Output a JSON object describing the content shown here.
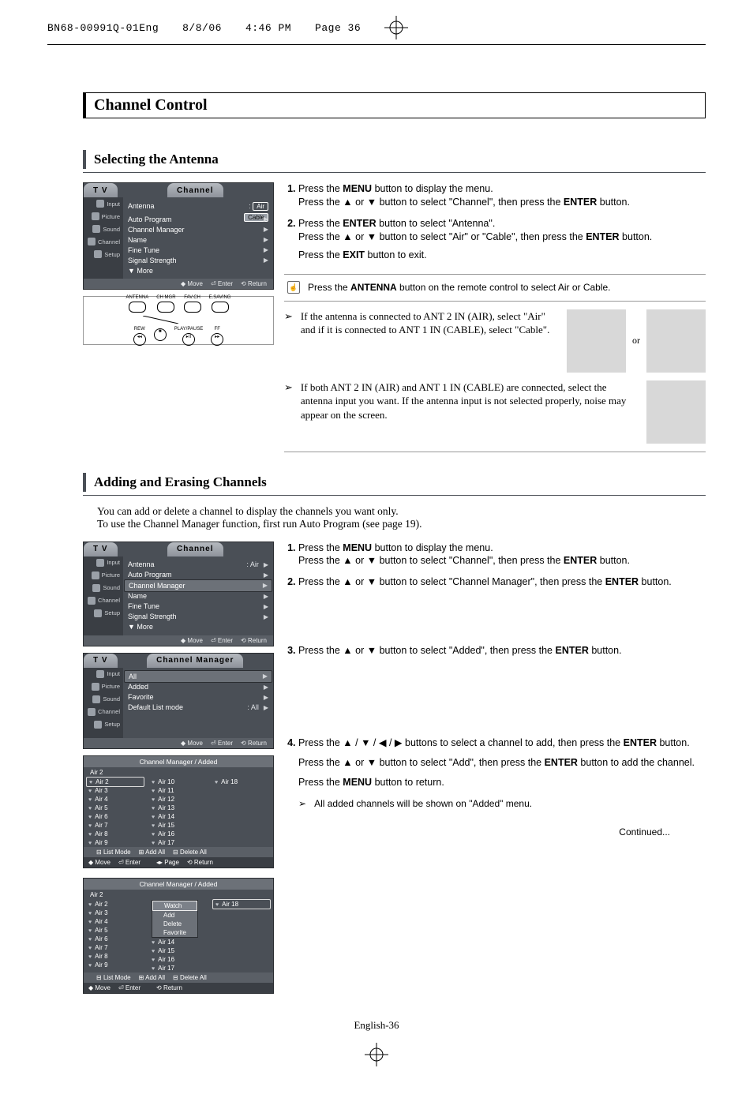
{
  "print_header": {
    "code": "BN68-00991Q-01Eng",
    "date": "8/8/06",
    "time": "4:46 PM",
    "page": "Page 36"
  },
  "main_title": "Channel Control",
  "section1": {
    "title": "Selecting the Antenna",
    "osd": {
      "tab_left": "T V",
      "tab_center": "Channel",
      "side": [
        "Input",
        "Picture",
        "Sound",
        "Channel",
        "Setup"
      ],
      "rows": [
        {
          "lbl": "Antenna",
          "val": ":",
          "opts": [
            "Air",
            "Cable"
          ],
          "sel": 0
        },
        {
          "lbl": "Auto Program",
          "tri": true
        },
        {
          "lbl": "Channel Manager",
          "tri": true
        },
        {
          "lbl": "Name",
          "tri": true
        },
        {
          "lbl": "Fine Tune",
          "tri": true
        },
        {
          "lbl": "Signal Strength",
          "tri": true
        },
        {
          "lbl": "▼ More"
        }
      ],
      "foot": [
        "Move",
        "Enter",
        "Return"
      ]
    },
    "remote_labels_top": [
      "ANTENNA",
      "CH MGR",
      "FAV.CH",
      "E.SAVING"
    ],
    "remote_labels_bot": [
      "REW",
      "",
      "PLAY/PAUSE",
      "FF"
    ],
    "steps": [
      {
        "n": "1.",
        "lines": [
          {
            "t": "Press the ",
            "b": "MENU",
            "t2": " button to display the menu."
          },
          {
            "t": "Press the ",
            "icon": "up",
            "t2": " or ",
            "icon2": "down",
            "t3": " button to select \"Channel\", then press the ",
            "b": "ENTER",
            "t4": " button."
          }
        ]
      },
      {
        "n": "2.",
        "lines": [
          {
            "t": "Press the ",
            "b": "ENTER",
            "t2": " button to select \"Antenna\"."
          },
          {
            "t": "Press the ",
            "icon": "up",
            "t2": " or ",
            "icon2": "down",
            "t3": " button to select \"Air\" or \"Cable\", then press the ",
            "b": "ENTER",
            "t4": " button."
          },
          {
            "t": "Press the ",
            "b": "EXIT",
            "t2": " button to exit."
          }
        ]
      }
    ],
    "note": {
      "pre": "Press the ",
      "b": "ANTENNA",
      "post": " button on the remote control to select Air or Cable."
    },
    "tip1": "If the antenna is connected to ANT 2 IN (AIR), select \"Air\" and if it is connected to ANT 1 IN (CABLE), select \"Cable\".",
    "tip1_or": "or",
    "tip2": "If both ANT 2 IN (AIR) and ANT 1 IN (CABLE) are connected, select the antenna input you want. If the antenna input is not selected properly, noise may appear on the screen."
  },
  "section2": {
    "title": "Adding and Erasing Channels",
    "intro1": "You can add or delete a channel to display the channels you want only.",
    "intro2": "To use the Channel Manager function, first run Auto Program (see page 19).",
    "osd1": {
      "tab_left": "T V",
      "tab_center": "Channel",
      "side": [
        "Input",
        "Picture",
        "Sound",
        "Channel",
        "Setup"
      ],
      "rows": [
        {
          "lbl": "Antenna",
          "val": ": Air",
          "tri": true
        },
        {
          "lbl": "Auto Program",
          "tri": true
        },
        {
          "lbl": "Channel Manager",
          "tri": true,
          "selected": true
        },
        {
          "lbl": "Name",
          "tri": true
        },
        {
          "lbl": "Fine Tune",
          "tri": true
        },
        {
          "lbl": "Signal Strength",
          "tri": true
        },
        {
          "lbl": "▼ More"
        }
      ],
      "foot": [
        "Move",
        "Enter",
        "Return"
      ]
    },
    "osd2": {
      "tab_left": "T V",
      "tab_center": "Channel Manager",
      "side": [
        "Input",
        "Picture",
        "Sound",
        "Channel",
        "Setup"
      ],
      "rows": [
        {
          "lbl": "All",
          "tri": true,
          "selected": true
        },
        {
          "lbl": "Added",
          "tri": true
        },
        {
          "lbl": "Favorite",
          "tri": true
        },
        {
          "lbl": "Default List mode",
          "val": ": All",
          "tri": true
        }
      ],
      "foot": [
        "Move",
        "Enter",
        "Return"
      ]
    },
    "chlist1": {
      "title": "Channel Manager / Added",
      "sub": "Air 2",
      "col1": [
        "Air 2",
        "Air 3",
        "Air 4",
        "Air 5",
        "Air 6",
        "Air 7",
        "Air 8",
        "Air 9"
      ],
      "col2": [
        "Air 10",
        "Air 11",
        "Air 12",
        "Air 13",
        "Air 14",
        "Air 15",
        "Air 16",
        "Air 17"
      ],
      "col3": [
        "Air 18"
      ],
      "foot_r": [
        "List Mode",
        "Add All",
        "Delete All"
      ],
      "foot_b": [
        "Move",
        "Enter",
        "Page",
        "Return"
      ]
    },
    "chlist2": {
      "title": "Channel Manager / Added",
      "sub": "Air 2",
      "col1": [
        "Air 2",
        "Air 3",
        "Air 4",
        "Air 5",
        "Air 6",
        "Air 7",
        "Air 8",
        "Air 9"
      ],
      "popup": [
        "Watch",
        "Add",
        "Delete",
        "Favorite"
      ],
      "popup_sel": 0,
      "col2_after": [
        "Air 14",
        "Air 15",
        "Air 16",
        "Air 17"
      ],
      "col3": [
        "Air 18"
      ],
      "foot_r": [
        "List Mode",
        "Add All",
        "Delete All"
      ],
      "foot_b": [
        "Move",
        "Enter",
        "",
        "Return"
      ]
    },
    "steps": [
      {
        "n": "1.",
        "lines": [
          {
            "t": "Press the ",
            "b": "MENU",
            "t2": " button to display the menu."
          },
          {
            "t": "Press the ",
            "icon": "up",
            "t2": " or ",
            "icon2": "down",
            "t3": " button to select \"Channel\", then press the ",
            "b": "ENTER",
            "t4": " button."
          }
        ]
      },
      {
        "n": "2.",
        "lines": [
          {
            "t": "Press the ",
            "icon": "up",
            "t2": " or ",
            "icon2": "down",
            "t3": " button to select \"Channel Manager\", then press the ",
            "b": "ENTER",
            "t4": " button."
          }
        ]
      },
      {
        "n": "3.",
        "lines": [
          {
            "t": "Press the ",
            "icon": "up",
            "t2": " or ",
            "icon2": "down",
            "t3": " button to select \"Added\", then press the ",
            "b": "ENTER",
            "t4": " button."
          }
        ]
      },
      {
        "n": "4.",
        "lines": [
          {
            "t": "Press the ",
            "icon": "up",
            "t2": " / ",
            "icon2": "down",
            "t3": " / ",
            "icon3": "left",
            "t4": " / ",
            "icon4": "right",
            "t5": " buttons to select a channel to add, then press the ",
            "b": "ENTER",
            "t6": " button."
          },
          {
            "t": "Press the ",
            "icon": "up",
            "t2": " or ",
            "icon2": "down",
            "t3": " button to select \"Add\", then press the ",
            "b": "ENTER",
            "t4": " button to add the channel."
          },
          {
            "t": "Press the ",
            "b": "MENU",
            "t2": " button to return."
          }
        ],
        "tip": "All added channels will be shown on \"Added\" menu."
      }
    ]
  },
  "continued": "Continued...",
  "pgnum": "English-36"
}
